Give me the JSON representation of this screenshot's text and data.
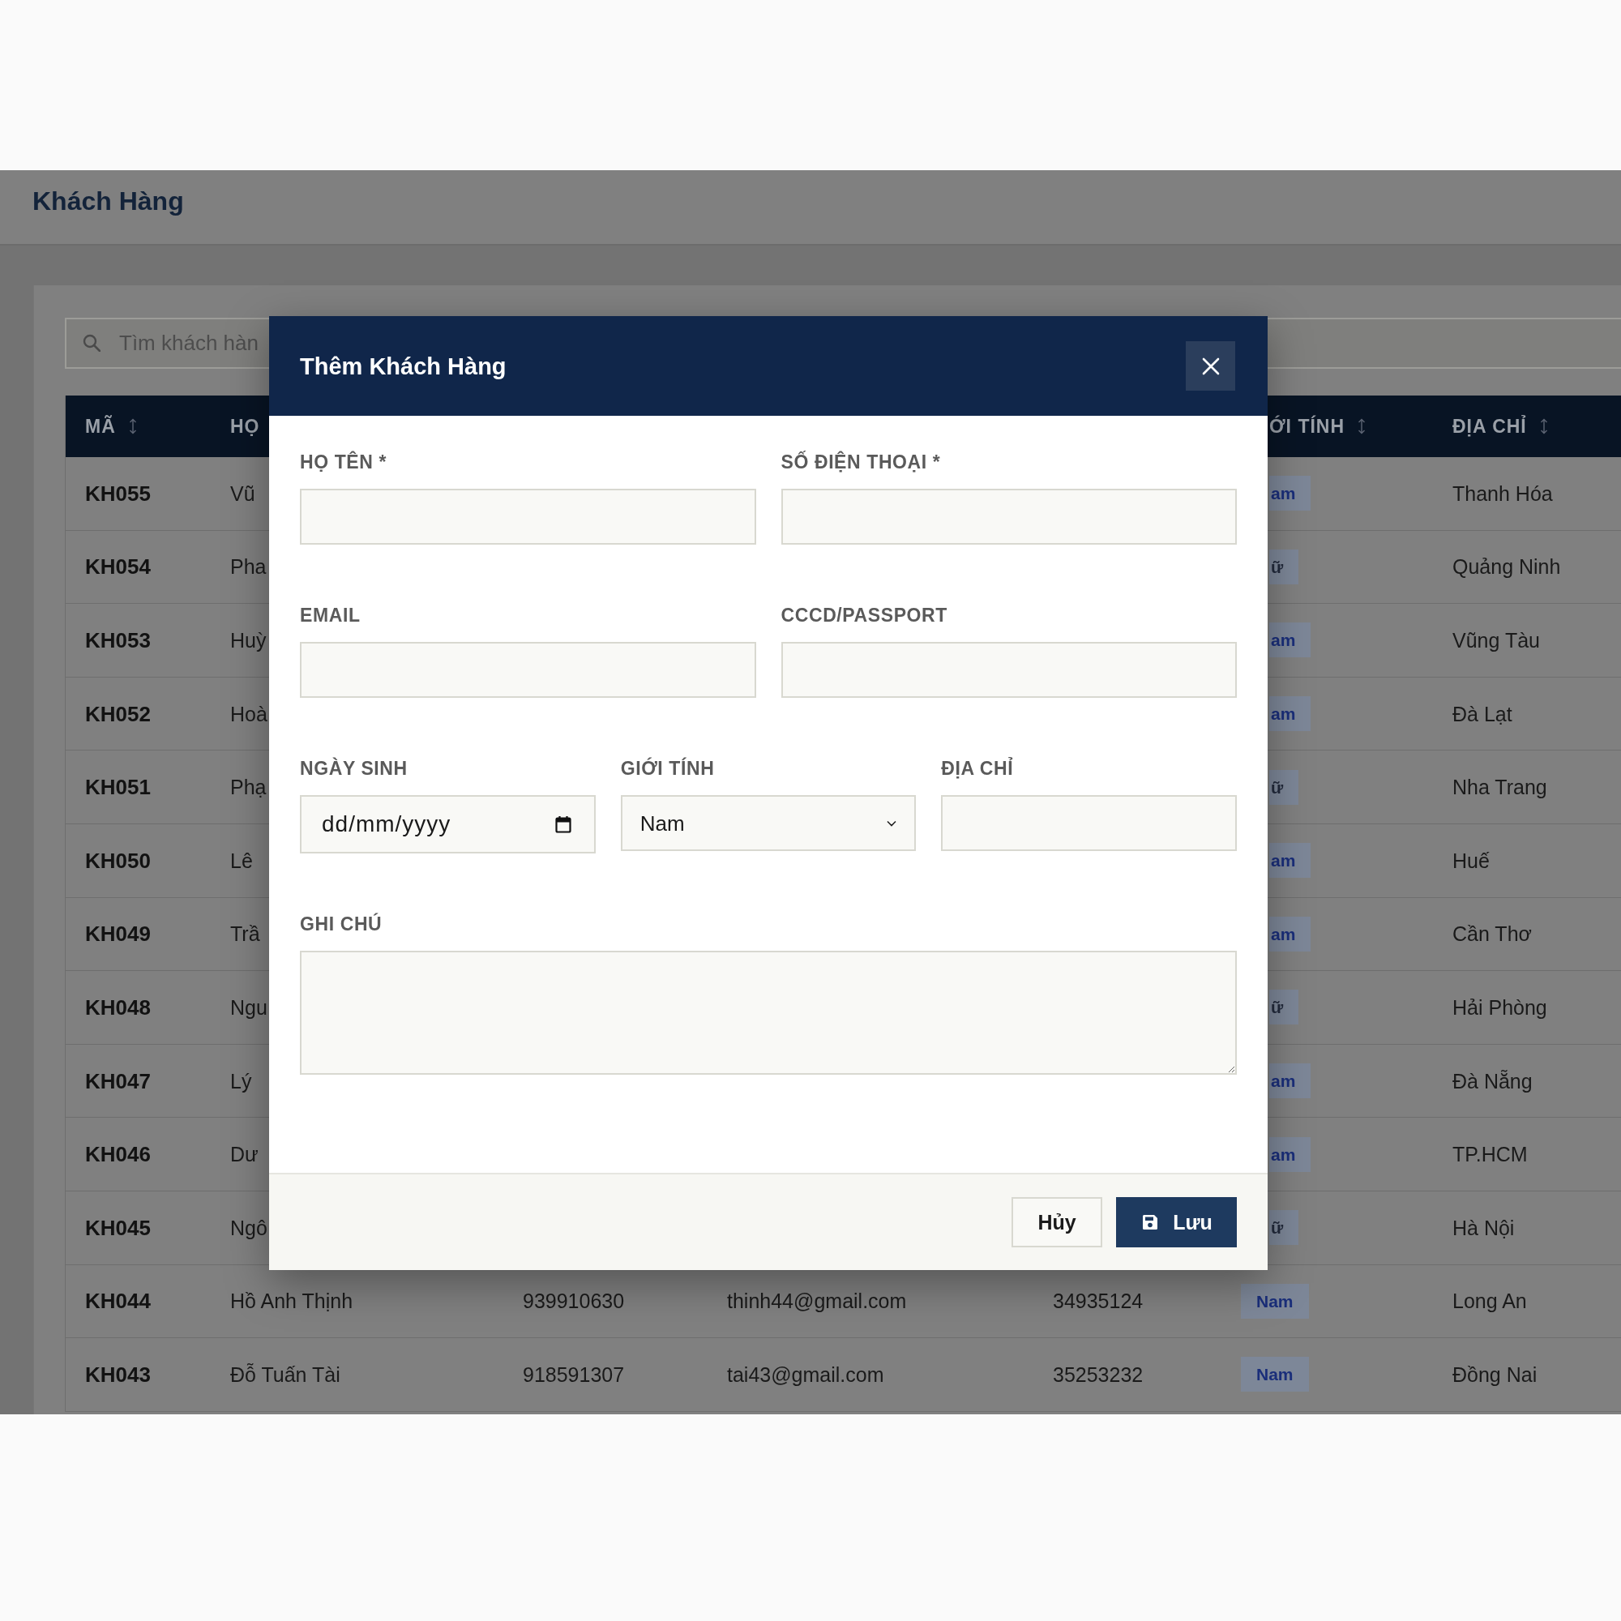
{
  "page": {
    "title": "Khách Hàng"
  },
  "search": {
    "placeholder": "Tìm khách hàn"
  },
  "table": {
    "header": {
      "code": {
        "label": "MÃ",
        "sortable": true
      },
      "name": {
        "label": "HỌ"
      },
      "gender": {
        "label": "ỚI TÍNH",
        "sortable": true,
        "partly_hidden": true
      },
      "address": {
        "label": "ĐỊA CHỈ",
        "sortable": true
      }
    },
    "rows": [
      {
        "code": "KH055",
        "name": "Vũ",
        "gender": {
          "label": "am",
          "kind": "male",
          "partly_hidden": true
        },
        "address": "Thanh Hóa"
      },
      {
        "code": "KH054",
        "name": "Pha",
        "gender": {
          "label": "ữ",
          "kind": "female",
          "partly_hidden": true
        },
        "address": "Quảng Ninh"
      },
      {
        "code": "KH053",
        "name": "Huỳ",
        "gender": {
          "label": "am",
          "kind": "male",
          "partly_hidden": true
        },
        "address": "Vũng Tàu"
      },
      {
        "code": "KH052",
        "name": "Hoà",
        "gender": {
          "label": "am",
          "kind": "male",
          "partly_hidden": true
        },
        "address": "Đà Lạt"
      },
      {
        "code": "KH051",
        "name": "Phạ",
        "gender": {
          "label": "ữ",
          "kind": "female",
          "partly_hidden": true
        },
        "address": "Nha Trang"
      },
      {
        "code": "KH050",
        "name": "Lê",
        "gender": {
          "label": "am",
          "kind": "male",
          "partly_hidden": true
        },
        "address": "Huế"
      },
      {
        "code": "KH049",
        "name": "Trầ",
        "gender": {
          "label": "am",
          "kind": "male",
          "partly_hidden": true
        },
        "address": "Cần Thơ"
      },
      {
        "code": "KH048",
        "name": "Ngu",
        "gender": {
          "label": "ữ",
          "kind": "female",
          "partly_hidden": true
        },
        "address": "Hải Phòng"
      },
      {
        "code": "KH047",
        "name": "Lý",
        "gender": {
          "label": "am",
          "kind": "male",
          "partly_hidden": true
        },
        "address": "Đà Nẵng"
      },
      {
        "code": "KH046",
        "name": "Dư",
        "gender": {
          "label": "am",
          "kind": "male",
          "partly_hidden": true
        },
        "address": "TP.HCM"
      },
      {
        "code": "KH045",
        "name": "Ngô",
        "gender": {
          "label": "ữ",
          "kind": "female",
          "partly_hidden": true
        },
        "address": "Hà Nội"
      },
      {
        "code": "KH044",
        "name": "Hồ Anh Thịnh",
        "phone": "939910630",
        "email": "thinh44@gmail.com",
        "id_number": "34935124",
        "gender": {
          "label": "Nam",
          "kind": "male",
          "partly_hidden": false
        },
        "address": "Long An"
      },
      {
        "code": "KH043",
        "name": "Đỗ Tuấn Tài",
        "phone": "918591307",
        "email": "tai43@gmail.com",
        "id_number": "35253232",
        "gender": {
          "label": "Nam",
          "kind": "male",
          "partly_hidden": false
        },
        "address": "Đồng Nai"
      }
    ]
  },
  "dialog": {
    "title": "Thêm Khách Hàng",
    "field_rows": [
      [
        {
          "kind": "text",
          "label": "HỌ TÊN *"
        },
        {
          "kind": "text",
          "label": "SỐ ĐIỆN THOẠI *"
        }
      ],
      [
        {
          "kind": "text",
          "label": "EMAIL"
        },
        {
          "kind": "text",
          "label": "CCCD/PASSPORT"
        }
      ],
      [
        {
          "kind": "date",
          "label": "NGÀY SINH",
          "placeholder": "dd/mm/yyyy"
        },
        {
          "kind": "select",
          "label": "GIỚI TÍNH",
          "value": "Nam"
        },
        {
          "kind": "text",
          "label": "ĐỊA CHỈ"
        }
      ],
      [
        {
          "kind": "textarea",
          "label": "GHI CHÚ"
        }
      ]
    ],
    "buttons": [
      {
        "kind": "secondary",
        "label": "Hủy"
      },
      {
        "kind": "primary",
        "label": "Lưu"
      }
    ]
  }
}
